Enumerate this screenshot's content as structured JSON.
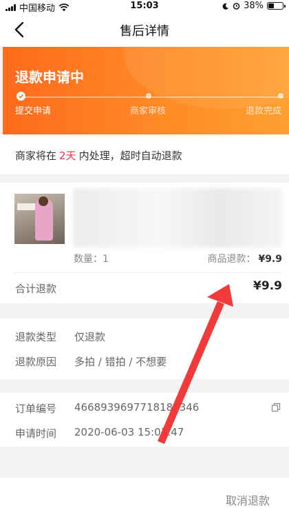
{
  "status_bar": {
    "carrier": "中国移动",
    "time": "15:03",
    "battery": "38%"
  },
  "nav": {
    "title": "售后详情",
    "back_icon": "chevron-left-icon"
  },
  "banner": {
    "title": "退款申请中",
    "steps": [
      {
        "label": "提交申请",
        "active": true
      },
      {
        "label": "商家审核",
        "active": false
      },
      {
        "label": "退款完成",
        "active": false
      }
    ],
    "color": "#ff7a20"
  },
  "notice": {
    "prefix": "商家将在",
    "days": "2天",
    "suffix": "内处理，超时自动退款",
    "highlight_color": "#ff2d4a"
  },
  "product": {
    "quantity": "数量：1",
    "item_refund_label": "商品退款：",
    "item_refund_value": "¥9.9",
    "total_label": "合计退款",
    "total_value": "¥9.9"
  },
  "refund_info": {
    "type_label": "退款类型",
    "type_value": "仅退款",
    "reason_label": "退款原因",
    "reason_value": "多拍 / 错拍 / 不想要"
  },
  "order_info": {
    "order_no_label": "订单编号",
    "order_no_value": "4668939697718182346",
    "apply_time_label": "申请时间",
    "apply_time_value": "2020-06-03 15:03:47"
  },
  "actions": {
    "cancel_label": "取消退款"
  }
}
